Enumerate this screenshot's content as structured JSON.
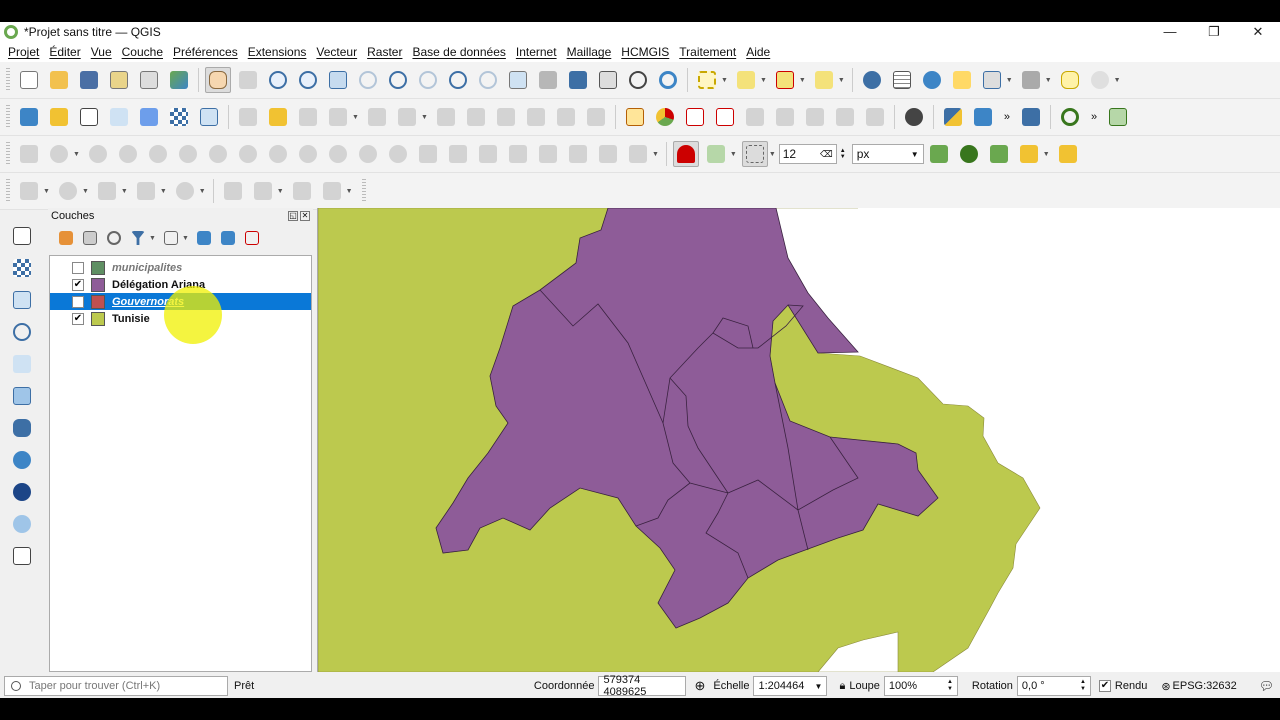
{
  "window": {
    "title": "*Projet sans titre — QGIS",
    "minimize": "—",
    "restore": "❐",
    "close": "✕"
  },
  "menu": [
    "Projet",
    "Éditer",
    "Vue",
    "Couche",
    "Préférences",
    "Extensions",
    "Vecteur",
    "Raster",
    "Base de données",
    "Internet",
    "Maillage",
    "HCMGIS",
    "Traitement",
    "Aide"
  ],
  "snapping": {
    "tolerance": "12",
    "unit": "px"
  },
  "layers_panel": {
    "title": "Couches",
    "layers": [
      {
        "name": "municipalites",
        "checked": false,
        "color": "#5f8f63",
        "style": "italic"
      },
      {
        "name": "Délégation Ariana",
        "checked": true,
        "color": "#8e5c98",
        "style": "bold"
      },
      {
        "name": "Gouvernorats",
        "checked": false,
        "color": "#c05050",
        "style": "selected"
      },
      {
        "name": "Tunisie",
        "checked": true,
        "color": "#bcc94e",
        "style": "bold"
      }
    ]
  },
  "map": {
    "land_color": "#bcc94e",
    "delegation_color": "#8e5c98",
    "sea_color": "#ffffff"
  },
  "status": {
    "locator_placeholder": "Taper pour trouver (Ctrl+K)",
    "message": "Prêt",
    "coord_label": "Coordonnée",
    "coord_value": "579374  4089625",
    "scale_label": "Échelle",
    "scale_value": "1:204464",
    "magnifier_label": "Loupe",
    "magnifier_value": "100%",
    "rotation_label": "Rotation",
    "rotation_value": "0,0 °",
    "render_label": "Rendu",
    "crs": "EPSG:32632"
  }
}
